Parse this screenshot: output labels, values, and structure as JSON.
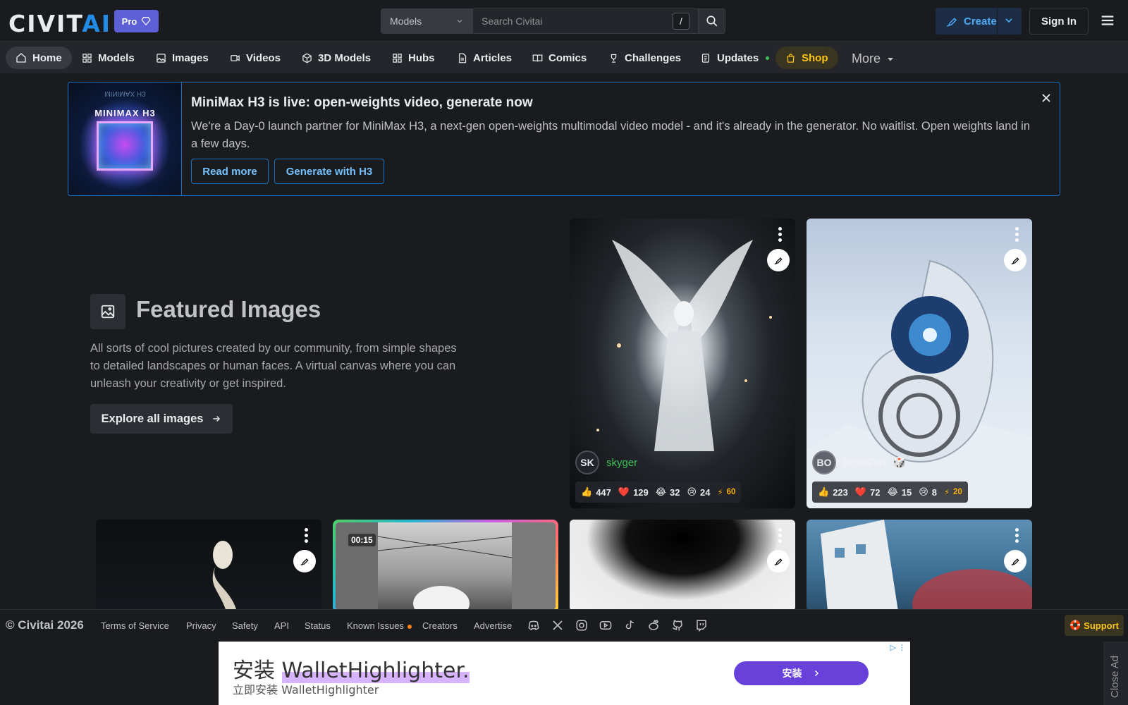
{
  "header": {
    "logo_main": "CIVIT",
    "logo_accent": "AI",
    "pro_label": "Pro",
    "search_category": "Models",
    "search_placeholder": "Search Civitai",
    "search_shortcut": "/",
    "create_label": "Create",
    "signin_label": "Sign In"
  },
  "nav": {
    "items": [
      {
        "label": "Home",
        "icon": "home-icon"
      },
      {
        "label": "Models",
        "icon": "grid-icon"
      },
      {
        "label": "Images",
        "icon": "image-icon"
      },
      {
        "label": "Videos",
        "icon": "video-icon"
      },
      {
        "label": "3D Models",
        "icon": "cube-icon"
      },
      {
        "label": "Hubs",
        "icon": "grid-icon"
      },
      {
        "label": "Articles",
        "icon": "file-icon"
      },
      {
        "label": "Comics",
        "icon": "book-icon"
      },
      {
        "label": "Challenges",
        "icon": "trophy-icon"
      },
      {
        "label": "Updates",
        "icon": "news-icon"
      },
      {
        "label": "Shop",
        "icon": "bag-icon"
      }
    ],
    "more_label": "More"
  },
  "announcement": {
    "image_text": "MINIMAX H3",
    "title": "MiniMax H3 is live: open-weights video, generate now",
    "text": "We're a Day-0 launch partner for MiniMax H3, a next-gen open-weights multimodal video model - and it's already in the generator. No waitlist. Open weights land in a few days.",
    "read_more": "Read more",
    "generate": "Generate with H3"
  },
  "featured": {
    "title": "Featured Images",
    "description": "All sorts of cool pictures created by our community, from simple shapes to detailed landscapes or human faces. A virtual canvas where you can unleash your creativity or get inspired.",
    "explore_label": "Explore all images"
  },
  "cards": [
    {
      "avatar": "SK",
      "user": "skyger",
      "user_color": "#40c057",
      "reactions": {
        "like": "447",
        "heart": "129",
        "laugh": "32",
        "cry": "24",
        "buzz": "60"
      }
    },
    {
      "avatar": "BO",
      "user": "Box4Fun",
      "user_color": "#e9ecef",
      "reactions": {
        "like": "223",
        "heart": "72",
        "laugh": "15",
        "cry": "8",
        "buzz": "20"
      }
    }
  ],
  "video": {
    "duration": "00:15"
  },
  "footer": {
    "copyright": "© Civitai 2026",
    "links": [
      "Terms of Service",
      "Privacy",
      "Safety",
      "API",
      "Status",
      "Known Issues",
      "Creators",
      "Advertise"
    ],
    "support_label": "Support"
  },
  "ad": {
    "title_prefix": "安装 ",
    "title_highlight": "WalletHighlighter.",
    "subtitle": "立即安装 WalletHighlighter",
    "button_label": "安装",
    "close_label": "Close Ad"
  }
}
